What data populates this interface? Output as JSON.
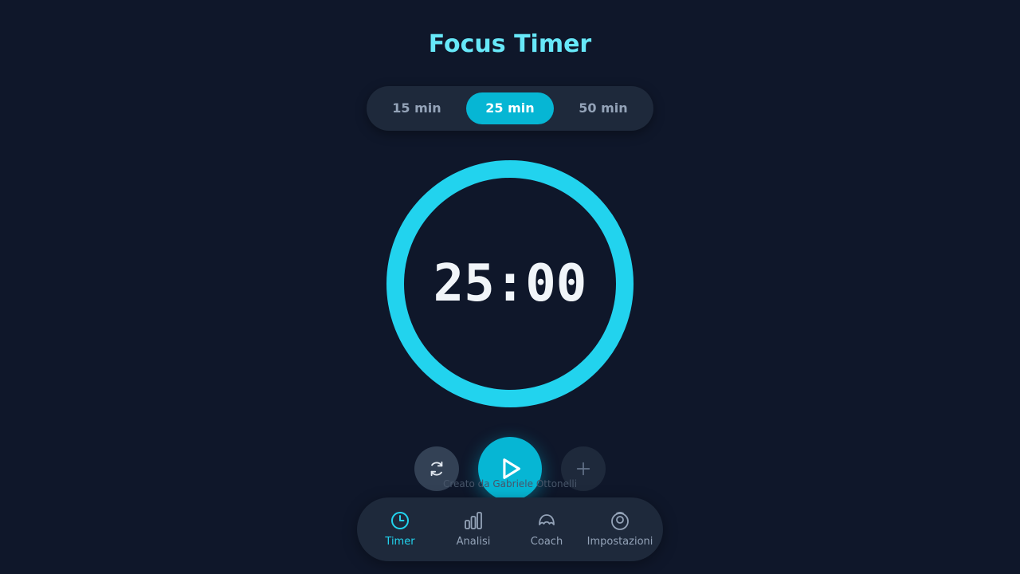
{
  "app": {
    "title": "Focus Timer"
  },
  "presets": {
    "items": [
      {
        "label": "15 min",
        "active": false
      },
      {
        "label": "25 min",
        "active": true
      },
      {
        "label": "50 min",
        "active": false
      }
    ]
  },
  "timer": {
    "display": "25:00",
    "progress": 1.0,
    "ring_color": "#22d3ee"
  },
  "controls": {
    "reset_icon": "reset-icon",
    "play_icon": "play-icon",
    "add_icon": "plus-icon"
  },
  "footer": {
    "credit": "Creato da Gabriele Ottonelli"
  },
  "nav": {
    "items": [
      {
        "label": "Timer",
        "icon": "clock-icon",
        "active": true
      },
      {
        "label": "Analisi",
        "icon": "bar-chart-icon",
        "active": false
      },
      {
        "label": "Coach",
        "icon": "coach-icon",
        "active": false
      },
      {
        "label": "Impostazioni",
        "icon": "settings-icon",
        "active": false
      }
    ]
  },
  "colors": {
    "background": "#0f172a",
    "accent": "#06b6d4",
    "title": "#67e8f9",
    "muted": "#94a3b8"
  }
}
